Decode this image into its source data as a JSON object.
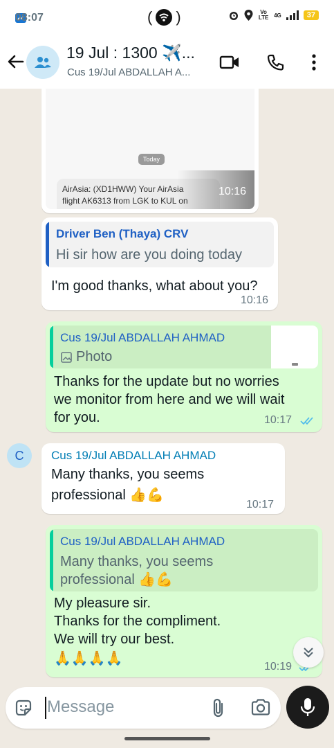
{
  "status_bar": {
    "time": "08:07",
    "center_text": "( )",
    "network_text": "Vo LTE",
    "signal_text": "4G",
    "battery": "37"
  },
  "header": {
    "title": "19 Jul : 1300 ✈️...",
    "subtitle": "Cus 19/Jul ABDALLAH A..."
  },
  "messages": {
    "m1": {
      "badge": "Today",
      "preview_text_1": "AirAsia: (XD1HWW) Your AirAsia",
      "preview_text_2": "flight AK6313 from LGK to KUL on",
      "time": "10:16"
    },
    "m2": {
      "quote_name": "Driver Ben (Thaya) CRV",
      "quote_text": "Hi sir how are you doing today",
      "text": "I'm good thanks, what about you?",
      "time": "10:16"
    },
    "m3": {
      "quote_name": "Cus 19/Jul ABDALLAH AHMAD",
      "quote_text": "Photo",
      "line1": "Thanks for the update but no worries",
      "line2": "we monitor from here and we will wait",
      "line3": "for you.",
      "time": "10:17"
    },
    "m4": {
      "avatar_letter": "C",
      "sender": "Cus 19/Jul ABDALLAH AHMAD",
      "line1": "Many thanks, you seems",
      "line2": "professional 👍💪",
      "time": "10:17"
    },
    "m5": {
      "quote_name": "Cus 19/Jul ABDALLAH AHMAD",
      "quote_line1": "Many thanks, you seems",
      "quote_line2": "professional 👍💪",
      "line1": "My pleasure sir.",
      "line2": "Thanks for the compliment.",
      "line3": "We will try our best.",
      "line4": "🙏🙏🙏🙏",
      "time": "10:19"
    }
  },
  "composer": {
    "placeholder": "Message"
  },
  "colors": {
    "chat_bg": "#efeae2",
    "incoming": "#ffffff",
    "outgoing": "#d9fdd3",
    "quote_bar_blue": "#1f60c4",
    "quote_bar_green": "#06cf9c",
    "name_teal": "#027eb5",
    "tick_blue": "#53bdeb"
  },
  "icons": [
    "back-arrow-icon",
    "group-icon",
    "video-call-icon",
    "phone-icon",
    "more-vert-icon",
    "sticker-icon",
    "attach-icon",
    "camera-icon",
    "mic-icon",
    "scroll-down-icon",
    "image-icon",
    "double-check-icon"
  ]
}
